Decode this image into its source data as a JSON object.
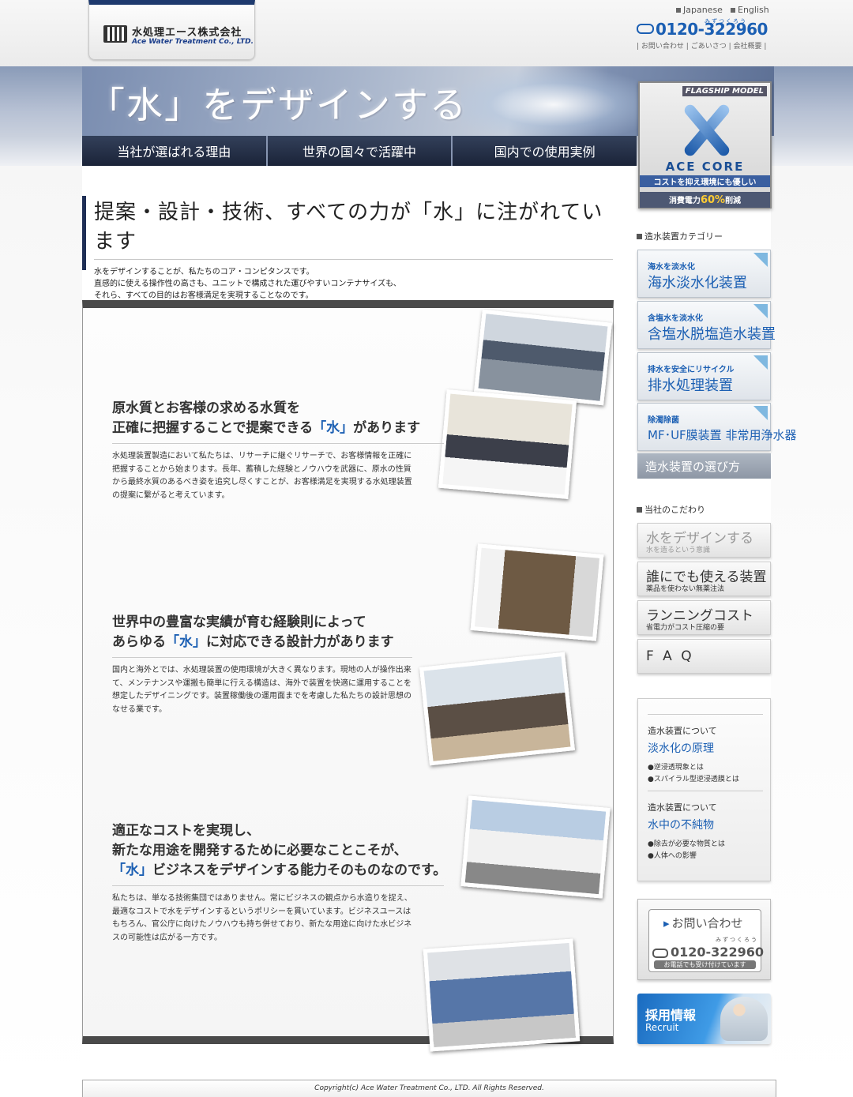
{
  "header": {
    "logo_jp": "水処理エース株式会社",
    "logo_en": "Ace Water Treatment Co., LTD.",
    "lang_ja": "Japanese",
    "lang_en": "English",
    "phone": "0120-322960",
    "phone_kana": "みずつくろう",
    "links": [
      "お問い合わせ",
      "ごあいさつ",
      "会社概要"
    ]
  },
  "hero": {
    "title": "「水」をデザインする",
    "nav": [
      "当社が選ばれる理由",
      "世界の国々で活躍中",
      "国内での使用実例"
    ],
    "flagship": {
      "label": "FLAGSHIP MODEL",
      "name": "ACE CORE",
      "tagline": "コストを抑え環境にも優しい",
      "power_prefix": "消費電力",
      "power_pct": "60%",
      "power_suffix": "削減"
    }
  },
  "intro": {
    "heading": "提案・設計・技術、すべての力が「水」に注がれています",
    "lines": [
      "水をデザインすることが、私たちのコア・コンピタンスです。",
      "直感的に使える操作性の高さも、ユニットで構成された運びやすいコンテナサイズも、",
      "それら、すべての目的はお客様満足を実現することなのです。"
    ]
  },
  "sections": [
    {
      "h_line1": "原水質とお客様の求める水質を",
      "h_line2_pre": "正確に把握することで提案できる",
      "h_line2_hl": "「水」",
      "h_line2_post": "があります",
      "body": "水処理装置製造において私たちは、リサーチに継ぐリサーチで、お客様情報を正確に把握することから始まります。長年、蓄積した経験とノウハウを武器に、原水の性質から最終水質のあるべき姿を追究し尽くすことが、お客様満足を実現する水処理装置の提案に繋がると考えています。"
    },
    {
      "h_line1": "世界中の豊富な実績が育む経験則によって",
      "h_line2_pre": "あらゆる",
      "h_line2_hl": "「水」",
      "h_line2_post": "に対応できる設計力があります",
      "body": "国内と海外とでは、水処理装置の使用環境が大きく異なります。現地の人が操作出来て、メンテナンスや運搬も簡単に行える構造は、海外で装置を快適に運用することを想定したデザイニングです。装置稼働後の運用面までを考慮した私たちの設計思想のなせる業です。"
    },
    {
      "h_line1": "適正なコストを実現し、",
      "h_line2": "新たな用途を開発するために必要なことこそが、",
      "h_line3_hl": "「水」",
      "h_line3_post": "ビジネスをデザインする能力そのものなのです。",
      "body": "私たちは、単なる技術集団ではありません。常にビジネスの観点から水造りを捉え、最適なコストで水をデザインするというポリシーを貫いています。ビジネスユースはもちろん、官公庁に向けたノウハウも持ち併せており、新たな用途に向けた水ビジネスの可能性は広がる一方です。"
    }
  ],
  "sidebar": {
    "cat_heading": "造水装置カテゴリー",
    "categories": [
      {
        "small": "海水を淡水化",
        "big": "海水淡水化装置"
      },
      {
        "small": "含塩水を淡水化",
        "big": "含塩水脱塩造水装置"
      },
      {
        "small": "排水を安全にリサイクル",
        "big": "排水処理装置"
      },
      {
        "small": "除濁除菌",
        "big": "MF･UF膜装置 非常用浄水器"
      }
    ],
    "choose": "造水装置の選び方",
    "kodawari_heading": "当社のこだわり",
    "kodawari": [
      {
        "big": "水をデザインする",
        "small": "水を造るという意識"
      },
      {
        "big": "誰にでも使える装置",
        "small": "薬品を使わない無薬注法"
      },
      {
        "big": "ランニングコスト",
        "small": "省電力がコスト圧縮の要"
      },
      {
        "big": "F A Q",
        "small": ""
      }
    ],
    "info": [
      {
        "about": "造水装置について",
        "title": "淡水化の原理",
        "items": [
          "●逆浸透現象とは",
          "●スパイラル型逆浸透膜とは"
        ]
      },
      {
        "about": "造水装置について",
        "title": "水中の不純物",
        "items": [
          "●除去が必要な物質とは",
          "●人体への影響"
        ]
      }
    ],
    "contact": {
      "title": "お問い合わせ",
      "phone": "0120-322960",
      "kana": "みずつくろう",
      "note": "お電話でも受け付けています"
    },
    "recruit": {
      "title": "採用情報",
      "en": "Recruit"
    }
  },
  "footer": "Copyright(c) Ace Water Treatment Co., LTD. All Rights Reserved."
}
